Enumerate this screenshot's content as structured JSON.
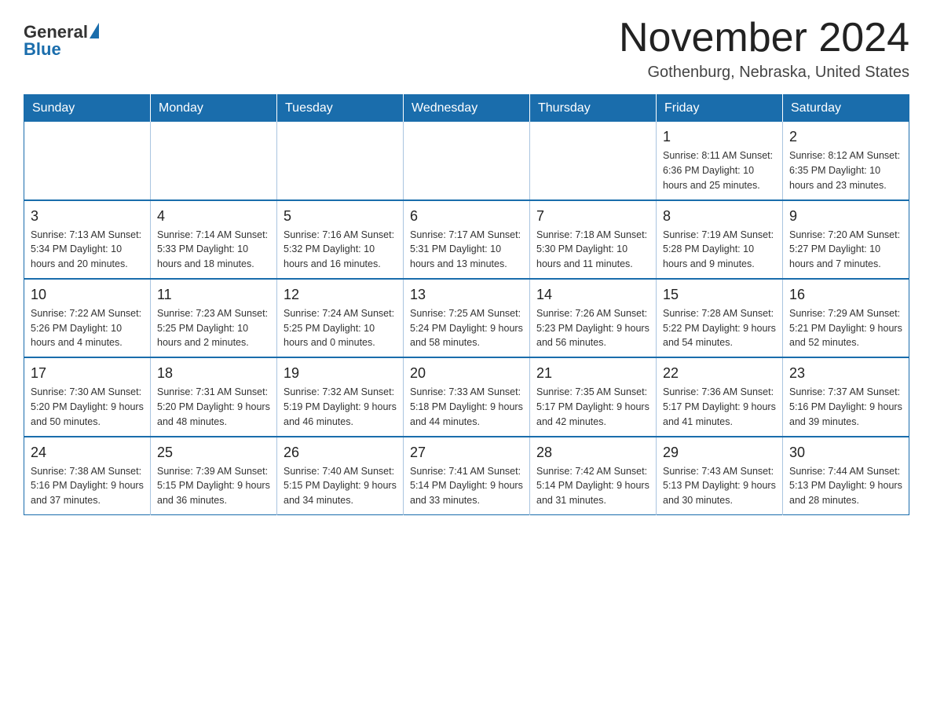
{
  "header": {
    "logo_general": "General",
    "logo_blue": "Blue",
    "month_title": "November 2024",
    "location": "Gothenburg, Nebraska, United States"
  },
  "days_of_week": [
    "Sunday",
    "Monday",
    "Tuesday",
    "Wednesday",
    "Thursday",
    "Friday",
    "Saturday"
  ],
  "weeks": [
    {
      "days": [
        {
          "number": "",
          "info": ""
        },
        {
          "number": "",
          "info": ""
        },
        {
          "number": "",
          "info": ""
        },
        {
          "number": "",
          "info": ""
        },
        {
          "number": "",
          "info": ""
        },
        {
          "number": "1",
          "info": "Sunrise: 8:11 AM\nSunset: 6:36 PM\nDaylight: 10 hours and 25 minutes."
        },
        {
          "number": "2",
          "info": "Sunrise: 8:12 AM\nSunset: 6:35 PM\nDaylight: 10 hours and 23 minutes."
        }
      ]
    },
    {
      "days": [
        {
          "number": "3",
          "info": "Sunrise: 7:13 AM\nSunset: 5:34 PM\nDaylight: 10 hours and 20 minutes."
        },
        {
          "number": "4",
          "info": "Sunrise: 7:14 AM\nSunset: 5:33 PM\nDaylight: 10 hours and 18 minutes."
        },
        {
          "number": "5",
          "info": "Sunrise: 7:16 AM\nSunset: 5:32 PM\nDaylight: 10 hours and 16 minutes."
        },
        {
          "number": "6",
          "info": "Sunrise: 7:17 AM\nSunset: 5:31 PM\nDaylight: 10 hours and 13 minutes."
        },
        {
          "number": "7",
          "info": "Sunrise: 7:18 AM\nSunset: 5:30 PM\nDaylight: 10 hours and 11 minutes."
        },
        {
          "number": "8",
          "info": "Sunrise: 7:19 AM\nSunset: 5:28 PM\nDaylight: 10 hours and 9 minutes."
        },
        {
          "number": "9",
          "info": "Sunrise: 7:20 AM\nSunset: 5:27 PM\nDaylight: 10 hours and 7 minutes."
        }
      ]
    },
    {
      "days": [
        {
          "number": "10",
          "info": "Sunrise: 7:22 AM\nSunset: 5:26 PM\nDaylight: 10 hours and 4 minutes."
        },
        {
          "number": "11",
          "info": "Sunrise: 7:23 AM\nSunset: 5:25 PM\nDaylight: 10 hours and 2 minutes."
        },
        {
          "number": "12",
          "info": "Sunrise: 7:24 AM\nSunset: 5:25 PM\nDaylight: 10 hours and 0 minutes."
        },
        {
          "number": "13",
          "info": "Sunrise: 7:25 AM\nSunset: 5:24 PM\nDaylight: 9 hours and 58 minutes."
        },
        {
          "number": "14",
          "info": "Sunrise: 7:26 AM\nSunset: 5:23 PM\nDaylight: 9 hours and 56 minutes."
        },
        {
          "number": "15",
          "info": "Sunrise: 7:28 AM\nSunset: 5:22 PM\nDaylight: 9 hours and 54 minutes."
        },
        {
          "number": "16",
          "info": "Sunrise: 7:29 AM\nSunset: 5:21 PM\nDaylight: 9 hours and 52 minutes."
        }
      ]
    },
    {
      "days": [
        {
          "number": "17",
          "info": "Sunrise: 7:30 AM\nSunset: 5:20 PM\nDaylight: 9 hours and 50 minutes."
        },
        {
          "number": "18",
          "info": "Sunrise: 7:31 AM\nSunset: 5:20 PM\nDaylight: 9 hours and 48 minutes."
        },
        {
          "number": "19",
          "info": "Sunrise: 7:32 AM\nSunset: 5:19 PM\nDaylight: 9 hours and 46 minutes."
        },
        {
          "number": "20",
          "info": "Sunrise: 7:33 AM\nSunset: 5:18 PM\nDaylight: 9 hours and 44 minutes."
        },
        {
          "number": "21",
          "info": "Sunrise: 7:35 AM\nSunset: 5:17 PM\nDaylight: 9 hours and 42 minutes."
        },
        {
          "number": "22",
          "info": "Sunrise: 7:36 AM\nSunset: 5:17 PM\nDaylight: 9 hours and 41 minutes."
        },
        {
          "number": "23",
          "info": "Sunrise: 7:37 AM\nSunset: 5:16 PM\nDaylight: 9 hours and 39 minutes."
        }
      ]
    },
    {
      "days": [
        {
          "number": "24",
          "info": "Sunrise: 7:38 AM\nSunset: 5:16 PM\nDaylight: 9 hours and 37 minutes."
        },
        {
          "number": "25",
          "info": "Sunrise: 7:39 AM\nSunset: 5:15 PM\nDaylight: 9 hours and 36 minutes."
        },
        {
          "number": "26",
          "info": "Sunrise: 7:40 AM\nSunset: 5:15 PM\nDaylight: 9 hours and 34 minutes."
        },
        {
          "number": "27",
          "info": "Sunrise: 7:41 AM\nSunset: 5:14 PM\nDaylight: 9 hours and 33 minutes."
        },
        {
          "number": "28",
          "info": "Sunrise: 7:42 AM\nSunset: 5:14 PM\nDaylight: 9 hours and 31 minutes."
        },
        {
          "number": "29",
          "info": "Sunrise: 7:43 AM\nSunset: 5:13 PM\nDaylight: 9 hours and 30 minutes."
        },
        {
          "number": "30",
          "info": "Sunrise: 7:44 AM\nSunset: 5:13 PM\nDaylight: 9 hours and 28 minutes."
        }
      ]
    }
  ]
}
